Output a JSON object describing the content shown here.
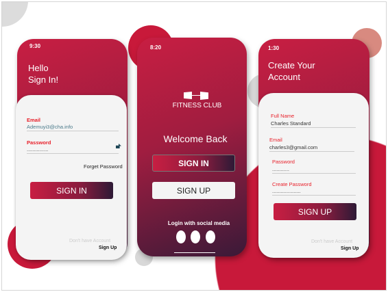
{
  "screens": {
    "signin": {
      "time": "9:30",
      "heading_line1": "Hello",
      "heading_line2": "Sign In!",
      "email_label": "Email",
      "email_value": "Ademuyi3@cha.info",
      "password_label": "Password",
      "password_value": "...............",
      "forget_password": "Forget Password",
      "sign_in_button": "SIGN IN",
      "no_account": "Don't have Account",
      "sign_up_link": "Sign Up"
    },
    "welcome": {
      "time": "8:20",
      "brand": "FITNESS CLUB",
      "title": "Welcome Back",
      "sign_in_button": "SIGN IN",
      "sign_up_button": "SIGN UP",
      "social_label": "Login with social media"
    },
    "signup": {
      "time": "1:30",
      "heading_line1": "Create Your",
      "heading_line2": "Account",
      "fullname_label": "Full Name",
      "fullname_value": "Charles Standard",
      "email_label": "Email",
      "email_value": "charles3@gmail.com",
      "password_label": "Password",
      "password_value": "............",
      "create_password_label": "Create Password",
      "create_password_value": "....................",
      "sign_up_button": "SIGN UP",
      "no_account": "Don't have Account",
      "sign_up_link": "Sign Up"
    }
  },
  "colors": {
    "accent": "#c8193a",
    "dark": "#2e1a36",
    "label": "#e8202a"
  }
}
